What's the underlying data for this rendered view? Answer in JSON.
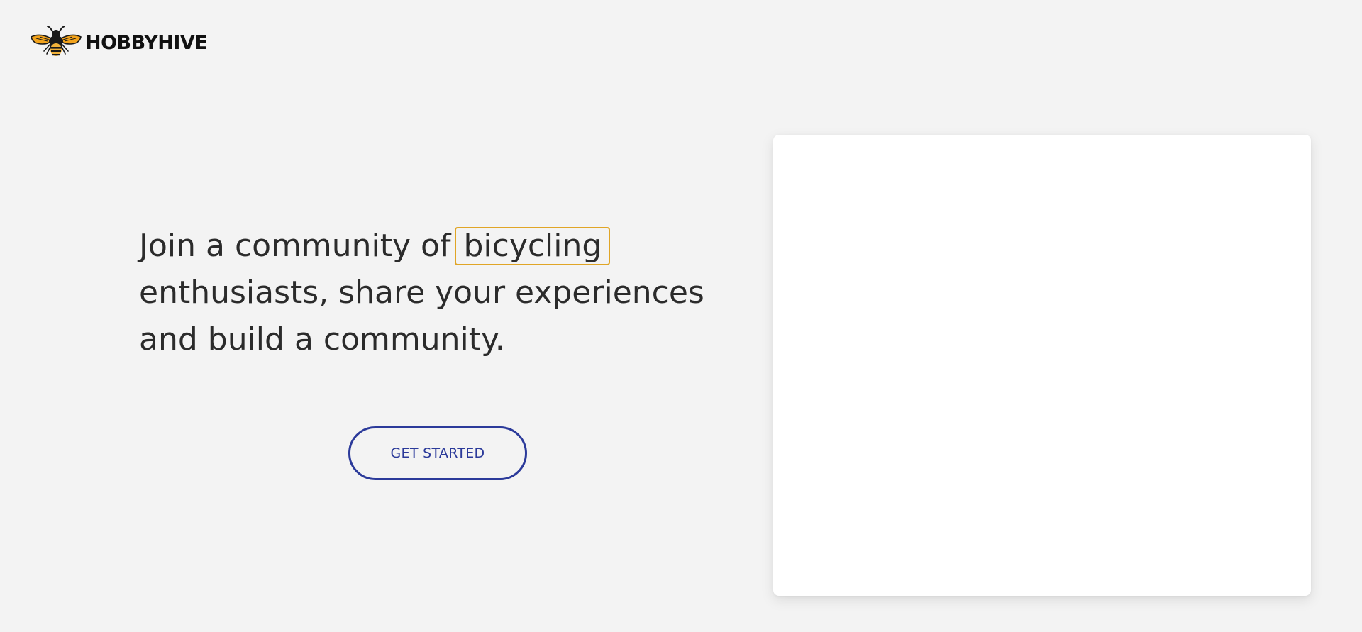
{
  "header": {
    "brand_name": "HOBBYHIVE",
    "logo_icon": "bee-icon"
  },
  "hero": {
    "text_before": "Join a community of",
    "highlight_word": "bicycling",
    "text_line2": "enthusiasts, share your experiences",
    "text_line3": "and build a community.",
    "cta_label": "GET STARTED"
  },
  "colors": {
    "background": "#f3f3f3",
    "highlight_border": "#e0a526",
    "cta_accent": "#2b3a9a",
    "panel": "#ffffff"
  }
}
